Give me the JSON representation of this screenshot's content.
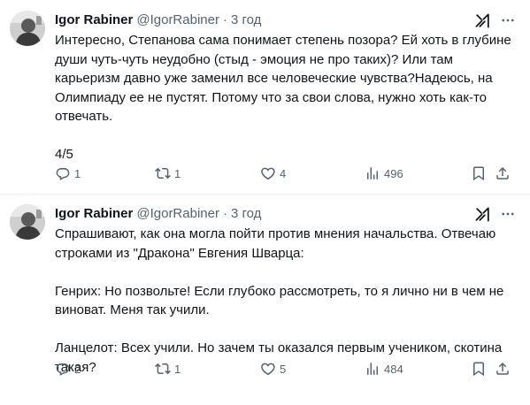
{
  "tweets": [
    {
      "author_name": "Igor Rabiner",
      "handle": "@IgorRabiner",
      "separator": "·",
      "time": "3 год",
      "text": "Интересно, Степанова сама понимает степень позора? Ей хоть в глубине\nдуши чуть-чуть неудобно (стыд - эмоция не про таких)? Или там\nкарьеризм давно уже заменил все человеческие чувства?Надеюсь, на\nОлимпиаду ее не пустят. Потому что за свои слова, нужно хоть как-то\nотвечать.\n\n4/5",
      "replies": "1",
      "reposts": "1",
      "likes": "4",
      "views": "496"
    },
    {
      "author_name": "Igor Rabiner",
      "handle": "@IgorRabiner",
      "separator": "·",
      "time": "3 год",
      "text": "Спрашивают, как она могла пойти против мнения начальства. Отвечаю\nстроками из \"Дракона\" Евгения Шварца:\n\nГенрих: Но позвольте! Если глубоко рассмотреть, то я лично ни в чем не\nвиноват. Меня так учили.\n\nЛанцелот: Всех учили. Но зачем ты оказался первым учеником, скотина\nтакая?",
      "replies": "2",
      "reposts": "1",
      "likes": "5",
      "views": "484"
    }
  ],
  "icons": {
    "avatar": "avatar-photo",
    "grok": "grok-icon",
    "more": "more-icon",
    "reply": "reply-icon",
    "repost": "repost-icon",
    "like": "heart-icon",
    "views": "views-icon",
    "bookmark": "bookmark-icon",
    "share": "share-icon"
  },
  "colors": {
    "text": "#0f1419",
    "secondary": "#536471",
    "divider": "#eff3f4"
  }
}
